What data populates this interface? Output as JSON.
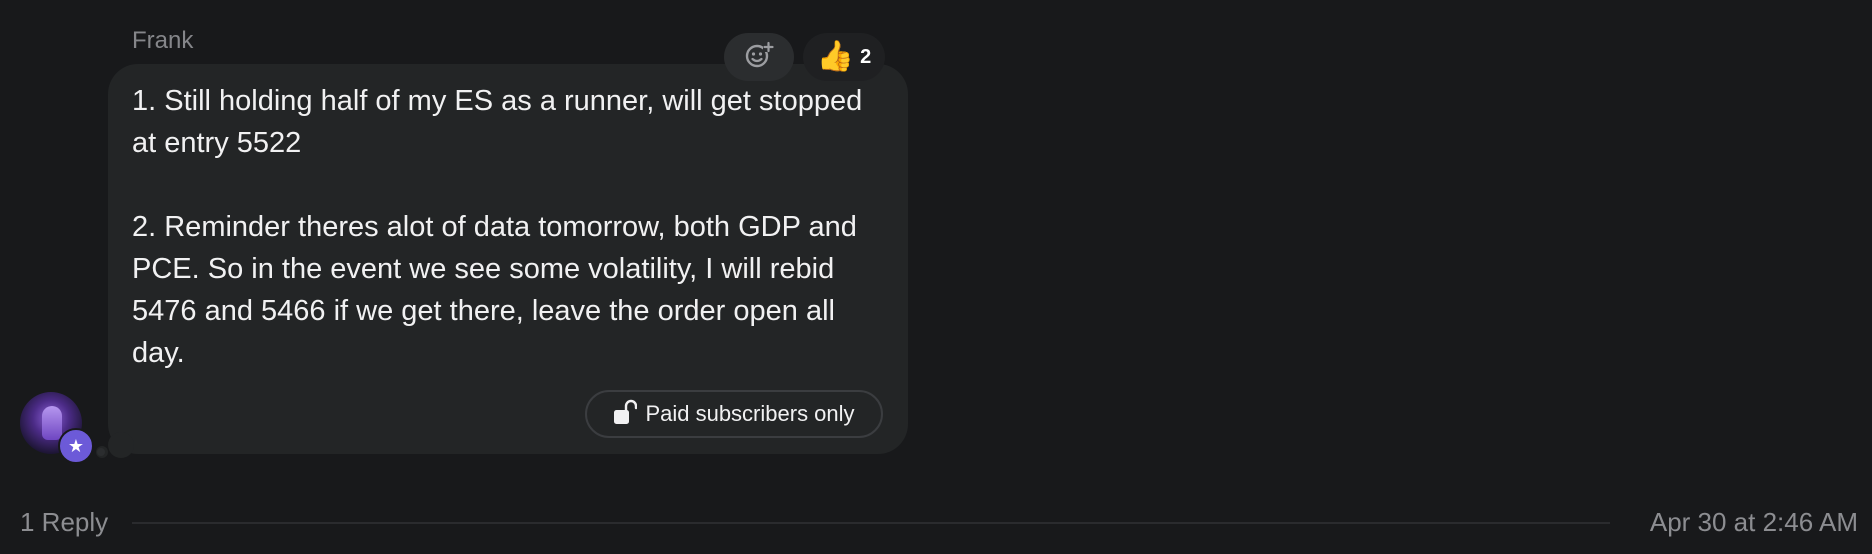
{
  "message": {
    "sender": "Frank",
    "paragraphs": [
      "1. Still holding half of my ES as a runner, will get stopped at entry 5522",
      "2. Reminder theres alot of data tomorrow, both GDP and PCE. So in the event we see some volatility, I will rebid 5476 and 5466 if we get there, leave the order open all day."
    ],
    "reactions": {
      "add_icon": "add-reaction-icon",
      "emoji": "👍",
      "count": "2"
    },
    "paid_chip": {
      "icon": "unlock-icon",
      "label": "Paid subscribers only"
    },
    "avatar_badge_icon": "star-icon"
  },
  "footer": {
    "replies": "1 Reply",
    "timestamp": "Apr 30 at 2:46 AM"
  },
  "colors": {
    "background": "#18191b",
    "bubble": "#232526",
    "text": "#f1f1f2",
    "muted": "#85868a",
    "badge": "#6c5ad8"
  }
}
